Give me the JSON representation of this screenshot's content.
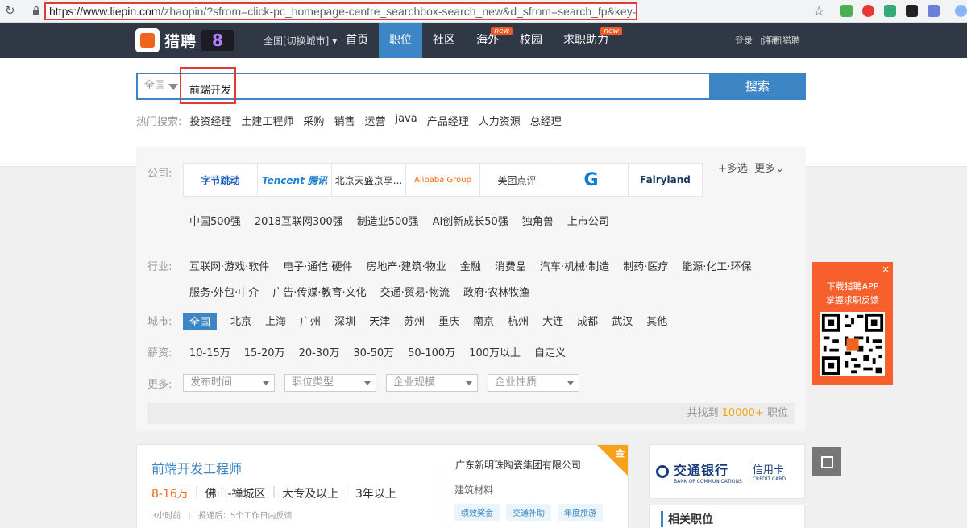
{
  "browser": {
    "url_main": "https://www.liepin.com",
    "url_path": "/zhaopin/?sfrom=click-pc_homepage-centre_searchbox-search_new&d_sfrom=search_fp&key=前端开发"
  },
  "nav": {
    "brand": "猎聘",
    "brand_badge": "8",
    "city_switch": "全国[切换城市]",
    "items": [
      {
        "label": "首页"
      },
      {
        "label": "职位",
        "active": true
      },
      {
        "label": "社区"
      },
      {
        "label": "海外",
        "badge": "new"
      },
      {
        "label": "校园"
      },
      {
        "label": "求职助力",
        "badge": "new"
      }
    ],
    "login": "登录",
    "register": "注册",
    "mobile": "手机猎聘"
  },
  "search": {
    "scope": "全国",
    "query": "前端开发",
    "button": "搜索",
    "hot_label": "热门搜索:",
    "hot_terms": [
      "投资经理",
      "土建工程师",
      "采购",
      "销售",
      "运营",
      "java",
      "产品经理",
      "人力资源",
      "总经理"
    ]
  },
  "filters": {
    "company_label": "公司:",
    "company_logos": [
      "字节跳动",
      "Tencent 腾讯",
      "北京天盛京享...",
      "Alibaba Group",
      "美团点评",
      "G",
      "Fairyland"
    ],
    "multi_select": "+多选",
    "more": "更多",
    "company_types": [
      "中国500强",
      "2018互联网300强",
      "制造业500强",
      "AI创新成长50强",
      "独角兽",
      "上市公司"
    ],
    "industry_label": "行业:",
    "industries_row1": [
      "互联网·游戏·软件",
      "电子·通信·硬件",
      "房地产·建筑·物业",
      "金融",
      "消费品",
      "汽车·机械·制造",
      "制药·医疗",
      "能源·化工·环保"
    ],
    "industries_row2": [
      "服务·外包·中介",
      "广告·传媒·教育·文化",
      "交通·贸易·物流",
      "政府·农林牧渔"
    ],
    "city_label": "城市:",
    "cities": [
      "全国",
      "北京",
      "上海",
      "广州",
      "深圳",
      "天津",
      "苏州",
      "重庆",
      "南京",
      "杭州",
      "大连",
      "成都",
      "武汉",
      "其他"
    ],
    "salary_label": "薪资:",
    "salaries": [
      "10-15万",
      "15-20万",
      "20-30万",
      "30-50万",
      "50-100万",
      "100万以上",
      "自定义"
    ],
    "more_label": "更多:",
    "selects": [
      "发布时间",
      "职位类型",
      "企业规模",
      "企业性质"
    ],
    "count_prefix": "共找到",
    "count": "10000+",
    "count_suffix": "职位"
  },
  "job": {
    "title": "前端开发工程师",
    "salary": "8-16万",
    "location": "佛山-禅城区",
    "education": "大专及以上",
    "experience": "3年以上",
    "posted": "3小时前",
    "feedback": "投递后：5个工作日内反馈",
    "company": "广东新明珠陶瓷集团有限公司",
    "industry": "建筑材料",
    "tags": [
      "绩效奖金",
      "交通补助",
      "年度旅游"
    ],
    "corner": "金"
  },
  "ad": {
    "bank": "交通银行",
    "bank_en": "BANK OF COMMUNICATIONS",
    "card": "信用卡",
    "card_en": "CREDIT CARD"
  },
  "related": {
    "title": "相关职位"
  },
  "qr_panel": {
    "close": "×",
    "line1": "下载猎聘APP",
    "line2": "掌握求职反馈"
  }
}
